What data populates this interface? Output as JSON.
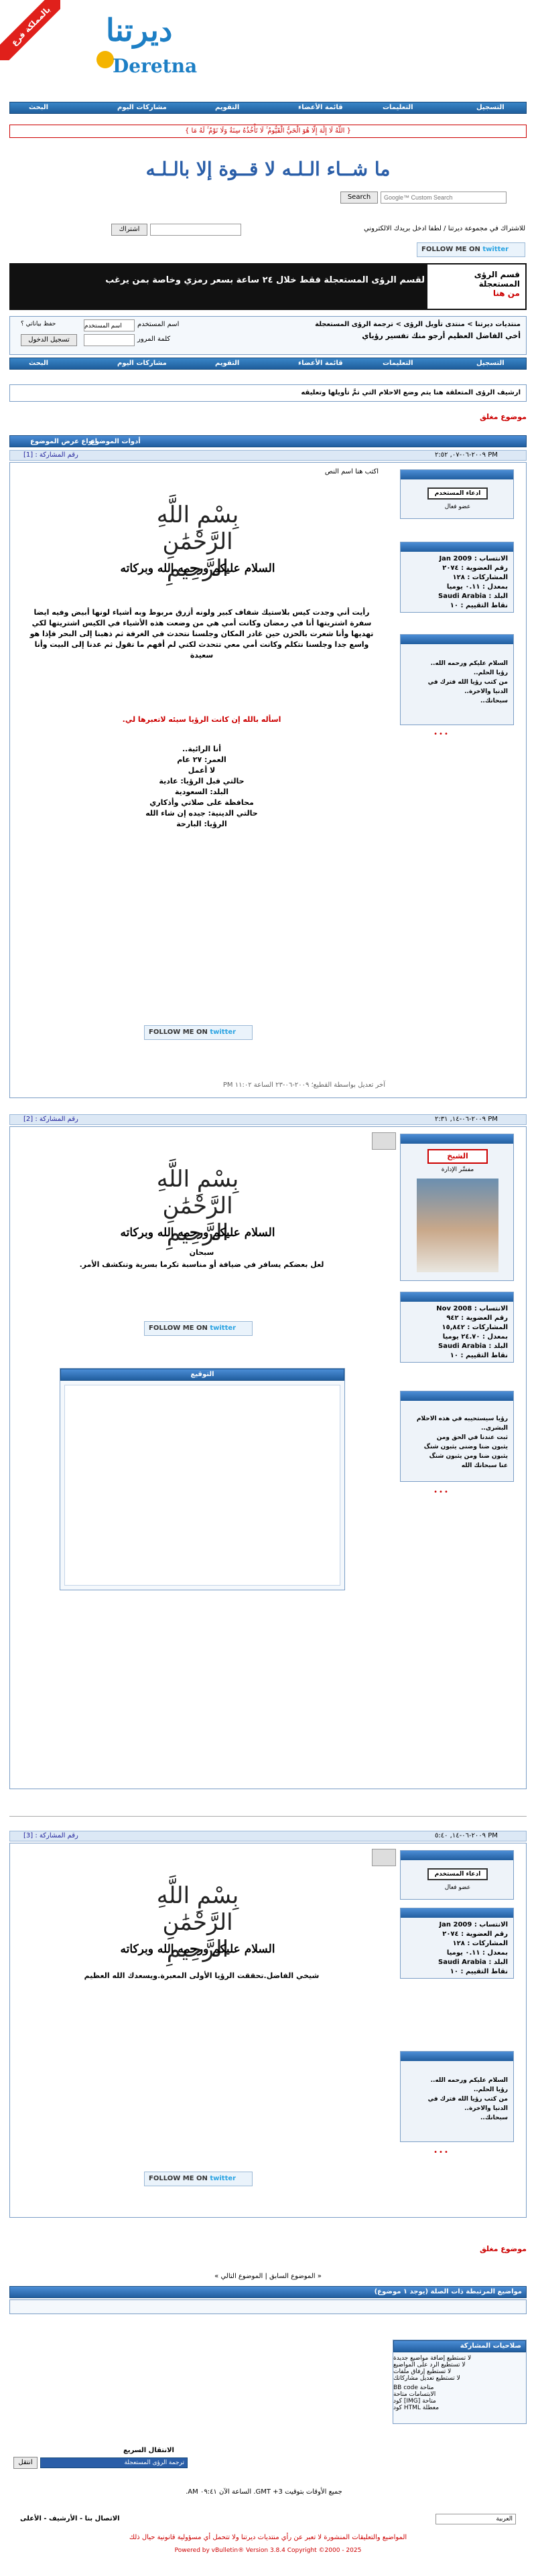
{
  "header": {
    "ribbon": "بالمملكة فرع",
    "logo_arabic": "ديرتنا",
    "logo_latin": "Deretna",
    "nav": [
      "التسجيل",
      "التعليمات",
      "قائمة الأعضاء",
      "التقويم",
      "مشاركات اليوم",
      "البحث"
    ],
    "verse": "{ اللَّهُ لَا إِلَٰهَ إِلَّا هُوَ الْحَيُّ الْقَيُّومُ ۚ لَا تَأْخُذُهُ سِنَةٌ وَلَا نَوْمٌ ۚ لَهُ مَا } ",
    "mashaallah": "ما شــاء الـلـه لا قــوة إلا بالـلـه",
    "search": {
      "button": "Search",
      "placeholder": "Google™ Custom Search"
    },
    "subscribe_text": "للاشتراك في مجموعة ديرتنا / لطفا ادخل بريدك الالكتروني",
    "subscribe_button": "اشتراك"
  },
  "twitter": {
    "follow": "FOLLOW ME ON",
    "brand": "twitter"
  },
  "promo": {
    "main": "لقسم الرؤى المستعجلة فقط خلال ٢٤ ساعة بسعر رمزي وخاصة بمن يرغب",
    "side_1": "قسم الرؤى المستعجلة",
    "side_2": "من هنا"
  },
  "breadcrumb": {
    "path": "منتديات ديرتنا > منتدى تأويل الرؤى > ترجمة الرؤى المستعجلة",
    "thread": "أخي الفاضل العظيم أرجو منك تفسير رؤياي",
    "username_label": "اسم المستخدم",
    "username_value": "اسم المستخدم",
    "password_label": "كلمة المرور",
    "remember": "حفظ بياناتي ؟",
    "login": "تسجيل الدخول"
  },
  "nav2": [
    "التسجيل",
    "التعليمات",
    "قائمة الأعضاء",
    "التقويم",
    "مشاركات اليوم",
    "البحث"
  ],
  "notice": "ارشيف الرؤى المتعلقة هنا يتم وضع الاحلام التي تمَّ تأويلها وتعليقه",
  "closed_tag": "موضوع مغلق",
  "thread_tools": {
    "tools": "أدوات الموضوع",
    "display": "انواع عرض الموضوع"
  },
  "posts": [
    {
      "date": "٢٠٠٩-٠٦-٠٧, ٢:٥٢ PM",
      "number": "رقم المشاركة : [1]",
      "title": "اكتب هنا اسم النص",
      "status_label": "ادعاء المستخدم",
      "user_rank": "عضو فعال",
      "joined": "الانتساب : Jan 2009",
      "age": "رقم العضوية : ٢٠٧٤",
      "posts": "المشاركات : ١٢٨",
      "gender": "بمعدل : ٠.١١ يوميا",
      "country": "البلد : Saudi Arabia",
      "points": "نقاط التقييم : ١٠",
      "sig_lines": [
        "السلام عليكم ورحمه الله..",
        "رؤيا الحلم..",
        "من كتب رؤيا الله فترك في",
        "الدنيا والاخرة..",
        "سبحانك.."
      ],
      "bism": "بِسْمِ اللَّهِ الرَّحْمَٰنِ الرَّحِيمِ",
      "salam": "السلام عليكم ورحمه الله وبركاته",
      "body": "رأيت أني وجدت كيس بلاستيك شفاف كبير ولونه أزرق مربوط وبه أشياء لونها أبيض وفيه ايضا سفرة اشتريتها أنا في رمضان وكانت أمي هي من وضعت هذه الأشياء في الكيس اشتريتها لكي تهديها وأنا شعرت بالحزن حين غادر المكان وجلسنا نتحدث في الغرفة ثم ذهبنا إلى البحر فإذا هو واسع جدا وجلسنا نتكلم وكانت أمي معي تتحدث لكني لم أفهم ما تقول ثم عدنا إلى البيت وأنا سعيدة",
      "question": "اسأله بالله إن كانت الرؤيا سيئه لاتعبرها لي.",
      "info": [
        "أنا الرائية..",
        "العمر: ٢٧ عام",
        "لا أعمل",
        "حالتي قبل الرؤيا: عادية",
        "البلد: السعودية",
        "محافظة على صلاتي وأذكاري",
        "حالتي الدينية: جيده إن شاء الله",
        "الرؤيا: البارحة"
      ],
      "edited": "آخر تعديل بواسطة القطيع؛ ٢٠٠٩-٠٦-٢٣ الساعة ١١:٠٢ PM"
    },
    {
      "date": "٢٠٠٩-٠٦-١٤, ٢:٣١ PM",
      "number": "رقم المشاركة : [2]",
      "status_label": "ادعاء المستخدم",
      "user_badge": "الشيخ",
      "user_rank": "مفسِّر الإدارة",
      "joined": "الانتساب : Nov 2008",
      "age": "رقم العضوية : ٩٤٢",
      "posts": "المشاركات : ١٥,٨٤٢",
      "gender": "بمعدل : ٢٤.٧٠ يوميا",
      "country": "البلد : Saudi Arabia",
      "points": "نقاط التقييم : ١٠",
      "sig_lines": [
        "رؤيا سيستحيبه في هذه الاحلام",
        "البشرى..",
        "ثبت عندنا في الحق ومن",
        "يثبون ضنا وضنى يثبون شنگ",
        "يثبون ضنا ومن يثبون شنگ",
        "عنا سبحانك الله"
      ],
      "bism": "بِسْمِ اللَّهِ الرَّحْمَٰنِ الرَّحِيمِ",
      "salam": "السلام عليكم ورحمه الله وبركاته",
      "body1": "سبحان",
      "body2": "لعل بعضكم يسافر في ضيافة أو مناسبة تكرما بسرية وتنكشف الأمر.",
      "sig_title": "التوقيع"
    },
    {
      "date": "٢٠٠٩-٠٦-١٤, ٥:٤٠ PM",
      "number": "رقم المشاركة : [3]",
      "status_label": "ادعاء المستخدم",
      "user_rank": "عضو فعال",
      "joined": "الانتساب : Jan 2009",
      "age": "رقم العضوية : ٢٠٧٤",
      "posts": "المشاركات : ١٢٨",
      "gender": "بمعدل : ٠.١١ يوميا",
      "country": "البلد : Saudi Arabia",
      "points": "نقاط التقييم : ١٠",
      "sig_lines": [
        "السلام عليكم ورحمه الله..",
        "رؤيا الحلم..",
        "من كتب رؤيا الله فترك في",
        "الدنيا والاخرة..",
        "سبحانك.."
      ],
      "bism": "بِسْمِ اللَّهِ الرَّحْمَٰنِ الرَّحِيمِ",
      "salam": "السلام عليكم ورحمه الله وبركاته",
      "body": "شيخي الفاضل.تحققت الرؤيا الأولى المعبرة.ويسعدك الله العظيم"
    }
  ],
  "nav_links": "« الموضوع السابق | الموضوع التالي »",
  "related_head": "مواضيع المرتبطة ذات الصلة (يوجد ١ موضوع)",
  "related": {
    "head": "صلاحيات المشاركة",
    "lines": [
      "لا تستطيع إضافة مواضيع جديدة",
      "لا تستطيع الرد على المواضيع",
      "لا تستطيع إرفاق ملفات",
      "لا تستطيع تعديل مشاركاتك"
    ],
    "codes": [
      "BB code متاحة",
      "الابتسامات متاحة",
      "كود [IMG] متاحة",
      "كود HTML معطلة"
    ]
  },
  "jump": {
    "label": "الانتقال السريع",
    "select": "ترجمة الرؤى المستعجلة",
    "go": "انتقل"
  },
  "footer": {
    "times": "جميع الأوقات بتوقيت GMT +3. الساعة الآن ٠٩:٤١ AM.",
    "lang": "العربية",
    "links": "الاتصال بنا - الأرشيف - الأعلى",
    "disclaimer": "المواضيع والتعليقات المنشورة لا تعبر عن رأي منتديات ديرتنا ولا تتحمل أي مسؤولية قانونية حيال ذلك",
    "copyright": "Powered by vBulletin® Version 3.8.4 Copyright ©2000 - 2025"
  }
}
